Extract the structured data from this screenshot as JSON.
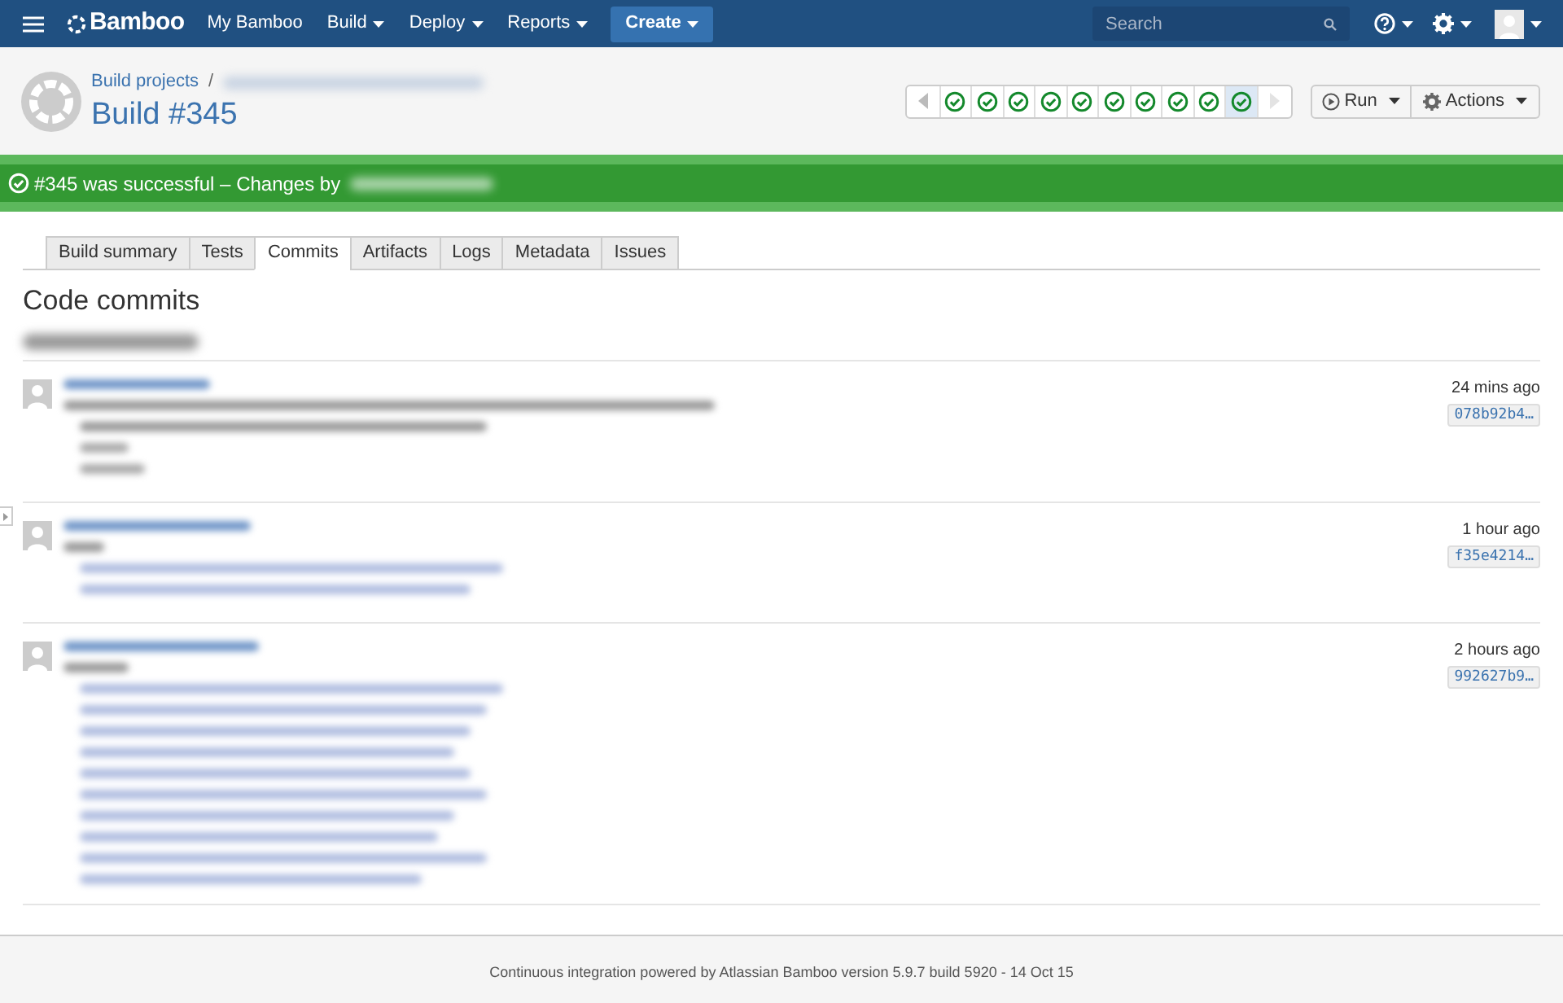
{
  "nav": {
    "logo": "Bamboo",
    "items": [
      {
        "label": "My Bamboo",
        "dropdown": false
      },
      {
        "label": "Build",
        "dropdown": true
      },
      {
        "label": "Deploy",
        "dropdown": true
      },
      {
        "label": "Reports",
        "dropdown": true
      }
    ],
    "create": "Create",
    "search": {
      "placeholder": "Search"
    }
  },
  "header": {
    "breadcrumb": "Build projects",
    "separator": "/",
    "title": "Build #345",
    "history": [
      {
        "kind": "success",
        "selected": false
      },
      {
        "kind": "success",
        "selected": false
      },
      {
        "kind": "success",
        "selected": false
      },
      {
        "kind": "success",
        "selected": false
      },
      {
        "kind": "success",
        "selected": false
      },
      {
        "kind": "success",
        "selected": false
      },
      {
        "kind": "success",
        "selected": false
      },
      {
        "kind": "success",
        "selected": false
      },
      {
        "kind": "success",
        "selected": false
      },
      {
        "kind": "success",
        "selected": true
      }
    ],
    "buttons": [
      "Run",
      "Actions"
    ]
  },
  "banner": {
    "kind": "success",
    "text": "#345 was successful – Changes by"
  },
  "tabs": [
    {
      "label": "Build summary",
      "selected": false
    },
    {
      "label": "Tests",
      "selected": false
    },
    {
      "label": "Commits",
      "selected": true
    },
    {
      "label": "Artifacts",
      "selected": false
    },
    {
      "label": "Logs",
      "selected": false
    },
    {
      "label": "Metadata",
      "selected": false
    },
    {
      "label": "Issues",
      "selected": false
    }
  ],
  "heading": "Code commits",
  "commits": [
    {
      "time": "24 mins ago",
      "hash": "078b92b4…"
    },
    {
      "time": "1 hour ago",
      "hash": "f35e4214…"
    },
    {
      "time": "2 hours ago",
      "hash": "992627b9…"
    }
  ],
  "footer": "Continuous integration powered by Atlassian Bamboo version 5.9.7 build 5920 - 14 Oct 15"
}
